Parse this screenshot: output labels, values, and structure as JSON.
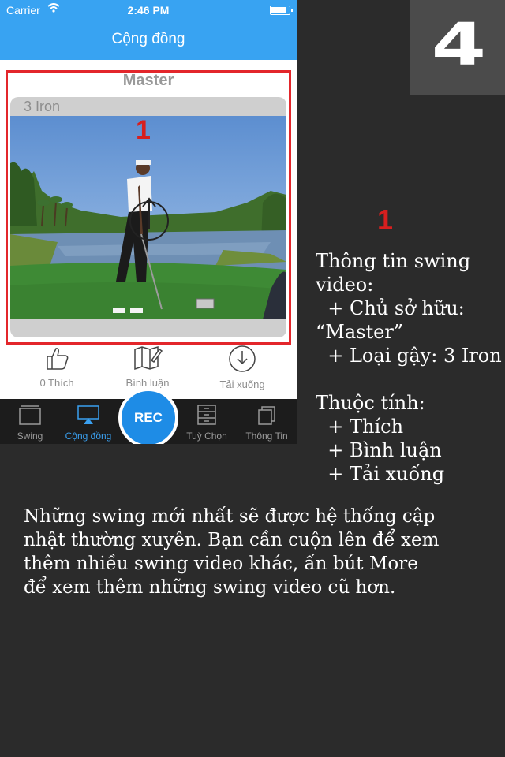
{
  "status_bar": {
    "carrier": "Carrier",
    "time": "2:46 PM",
    "battery_level": 0.9
  },
  "nav": {
    "title": "Cộng đồng"
  },
  "card": {
    "owner": "Master",
    "club": "3 Iron",
    "marker": "1",
    "actions": {
      "like": "0 Thích",
      "comment": "Bình luận",
      "download": "Tải xuống"
    }
  },
  "tabs": [
    {
      "label": "Swing",
      "icon": "film-icon"
    },
    {
      "label": "Cộng đồng",
      "icon": "airplay-icon"
    },
    {
      "label": "Tuỳ Chọn",
      "icon": "drawer-icon"
    },
    {
      "label": "Thông Tin",
      "icon": "documents-icon"
    }
  ],
  "rec_label": "REC",
  "step": "4",
  "side_marker": "1",
  "info_text": "Thông tin swing\nvideo:\n  + Chủ sở hữu:\n“Master”\n  + Loại gậy: 3 Iron",
  "attributes_text": "Thuộc tính:\n  + Thích\n  + Bình luận\n  + Tải xuống",
  "note_text": "Những swing mới nhất sẽ được hệ thống cập\nnhật thường xuyên. Bạn cần cuộn lên để xem\nthêm nhiều swing video khác, ấn bút More\nđể xem thêm những swing video cũ hơn.",
  "colors": {
    "accent": "#38a3f2",
    "highlight": "#e3262b",
    "background": "#2b2b2b"
  }
}
